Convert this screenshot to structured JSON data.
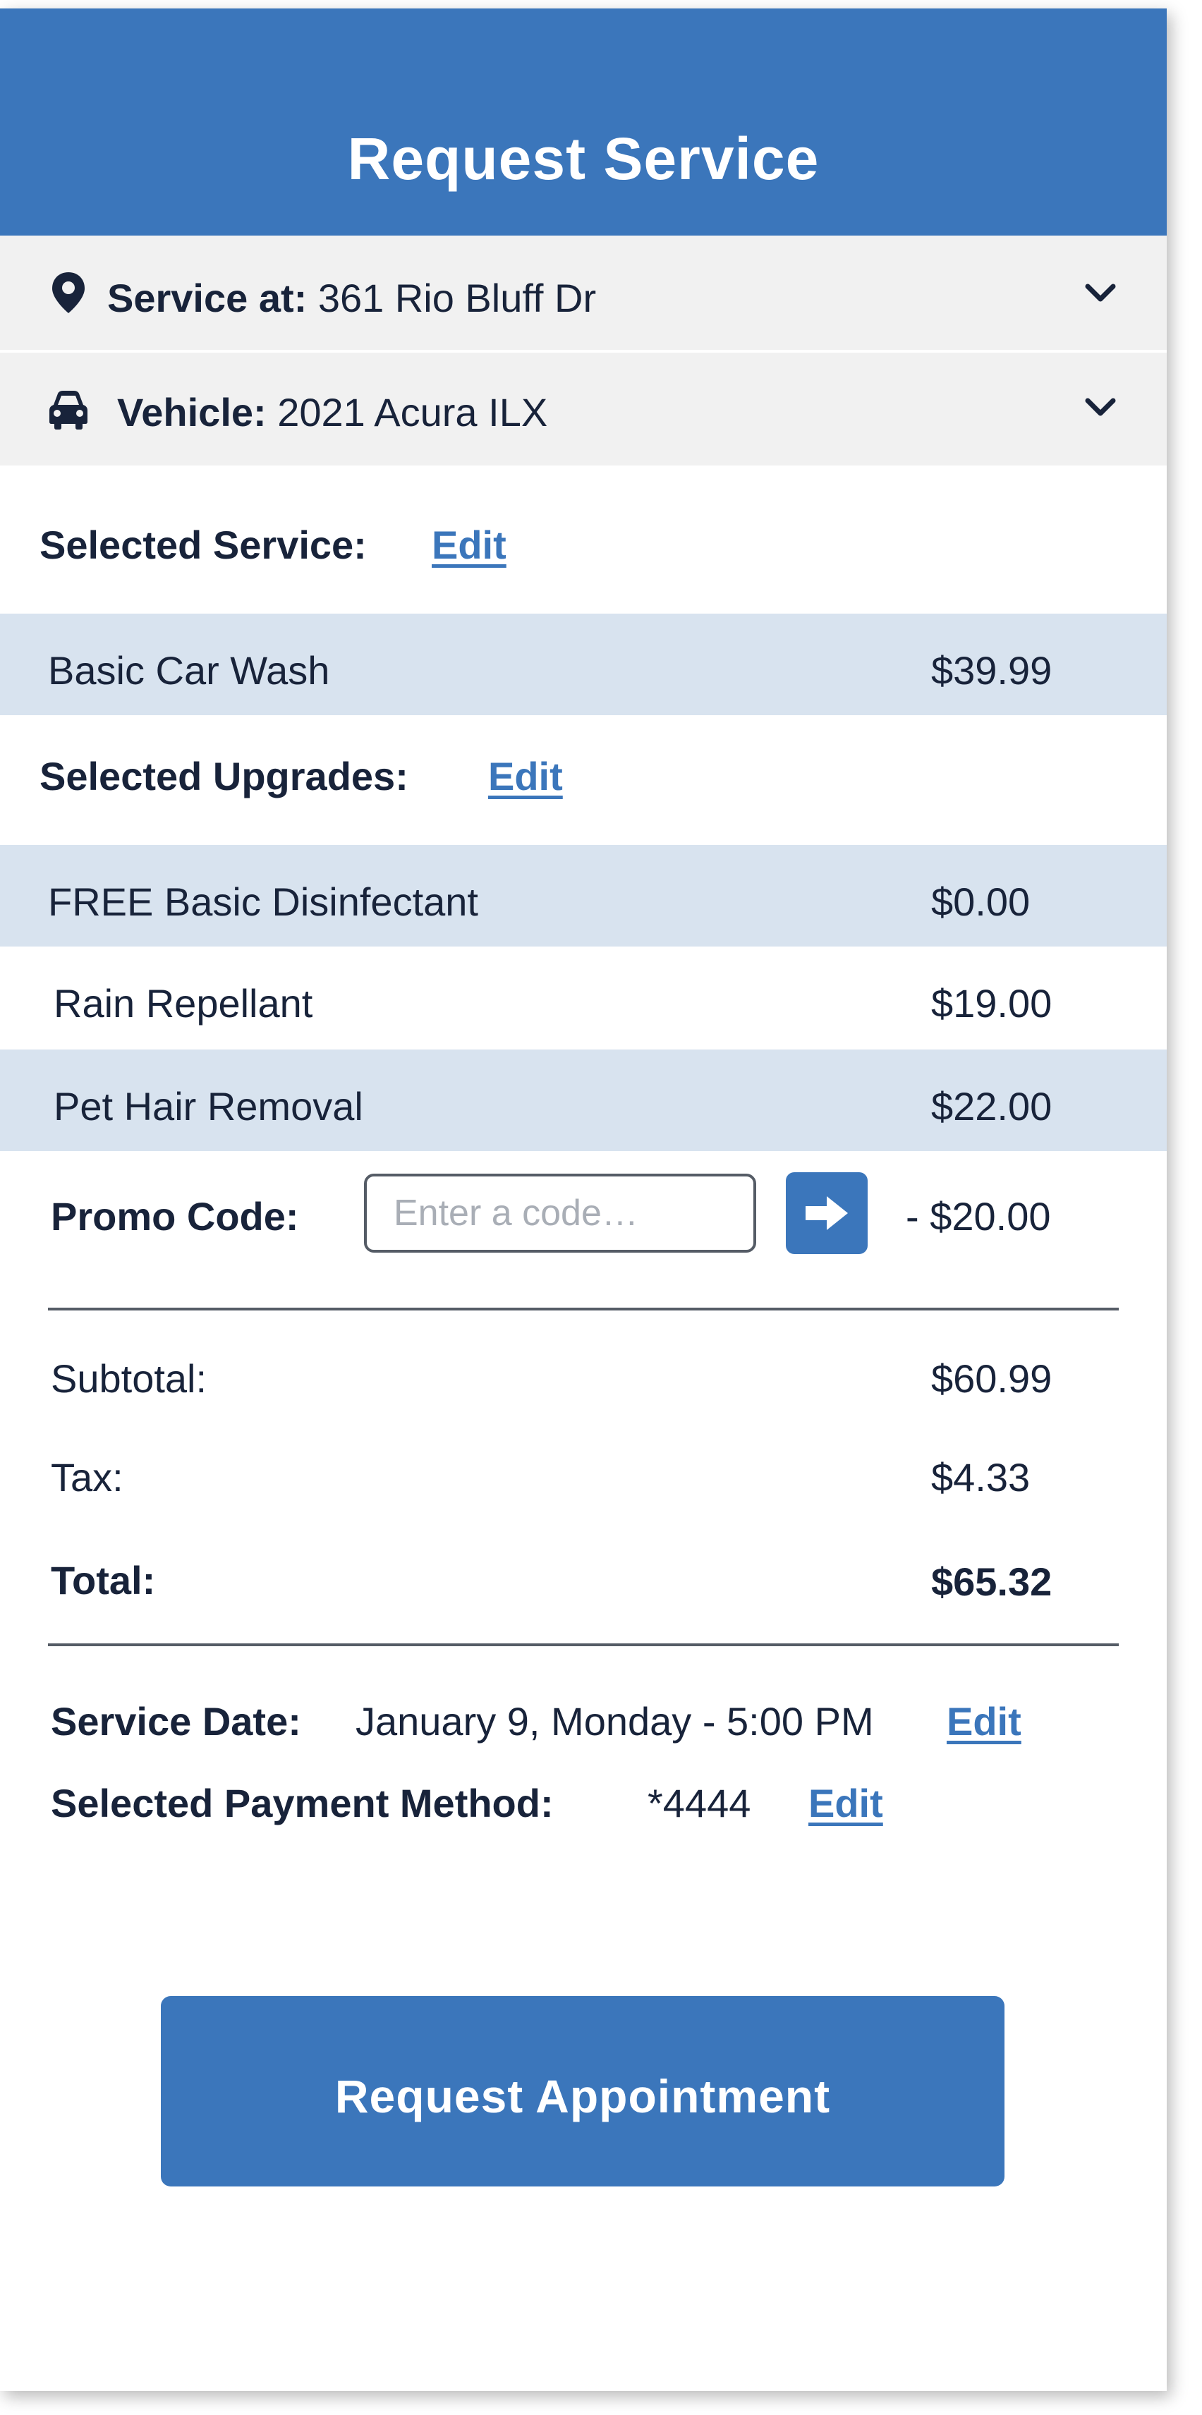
{
  "header": {
    "title": "Request Service"
  },
  "location": {
    "icon": "map-pin-icon",
    "label": "Service at:",
    "value": "361 Rio Bluff Dr"
  },
  "vehicle": {
    "icon": "car-icon",
    "label": "Vehicle:",
    "value": "2021 Acura ILX"
  },
  "selected_service": {
    "heading": "Selected Service:",
    "edit_label": "Edit",
    "items": [
      {
        "name": "Basic Car Wash",
        "price": "$39.99"
      }
    ]
  },
  "selected_upgrades": {
    "heading": "Selected Upgrades:",
    "edit_label": "Edit",
    "items": [
      {
        "name": "FREE Basic Disinfectant",
        "price": "$0.00"
      },
      {
        "name": "Rain Repellant",
        "price": "$19.00"
      },
      {
        "name": "Pet Hair Removal",
        "price": "$22.00"
      }
    ]
  },
  "promo": {
    "label": "Promo Code:",
    "placeholder": "Enter a code…",
    "value": "",
    "submit_icon": "arrow-right-icon",
    "discount": "- $20.00"
  },
  "summary": {
    "subtotal_label": "Subtotal:",
    "subtotal_value": "$60.99",
    "tax_label": "Tax:",
    "tax_value": "$4.33",
    "total_label": "Total:",
    "total_value": "$65.32"
  },
  "details": {
    "date_label": "Service Date:",
    "date_value": "January 9, Monday - 5:00 PM",
    "date_edit": "Edit",
    "payment_label": "Selected Payment Method:",
    "payment_value": "*4444",
    "payment_edit": "Edit"
  },
  "cta": {
    "label": "Request Appointment"
  },
  "colors": {
    "brand_blue": "#3b76bb",
    "row_shade": "#d8e3ef",
    "accordion_bg": "#f1f1f1",
    "text_dark": "#18233a"
  }
}
